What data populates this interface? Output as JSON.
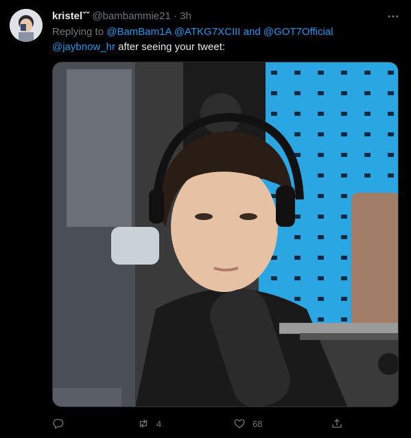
{
  "tweet": {
    "display_name": "kristelˇˇ",
    "handle": "@bambammie21",
    "separator": "·",
    "time": "3h",
    "reply_prefix": "Replying to",
    "mentions": [
      "@BamBam1A",
      "@ATKG7XCIII",
      "@GOT7Official"
    ],
    "and_word": "and",
    "text_mention": "@jaybnow_hr",
    "text_body": " after seeing your tweet:",
    "media_alt": "photo"
  },
  "actions": {
    "reply_count": "",
    "retweet_count": "4",
    "like_count": "68"
  },
  "colors": {
    "background": "#000000",
    "mention": "#1d9bf0",
    "secondary_text": "#71767b",
    "primary_text": "#e7e9ea"
  },
  "icons": [
    "reply-icon",
    "retweet-icon",
    "like-icon",
    "share-icon",
    "more-icon"
  ]
}
